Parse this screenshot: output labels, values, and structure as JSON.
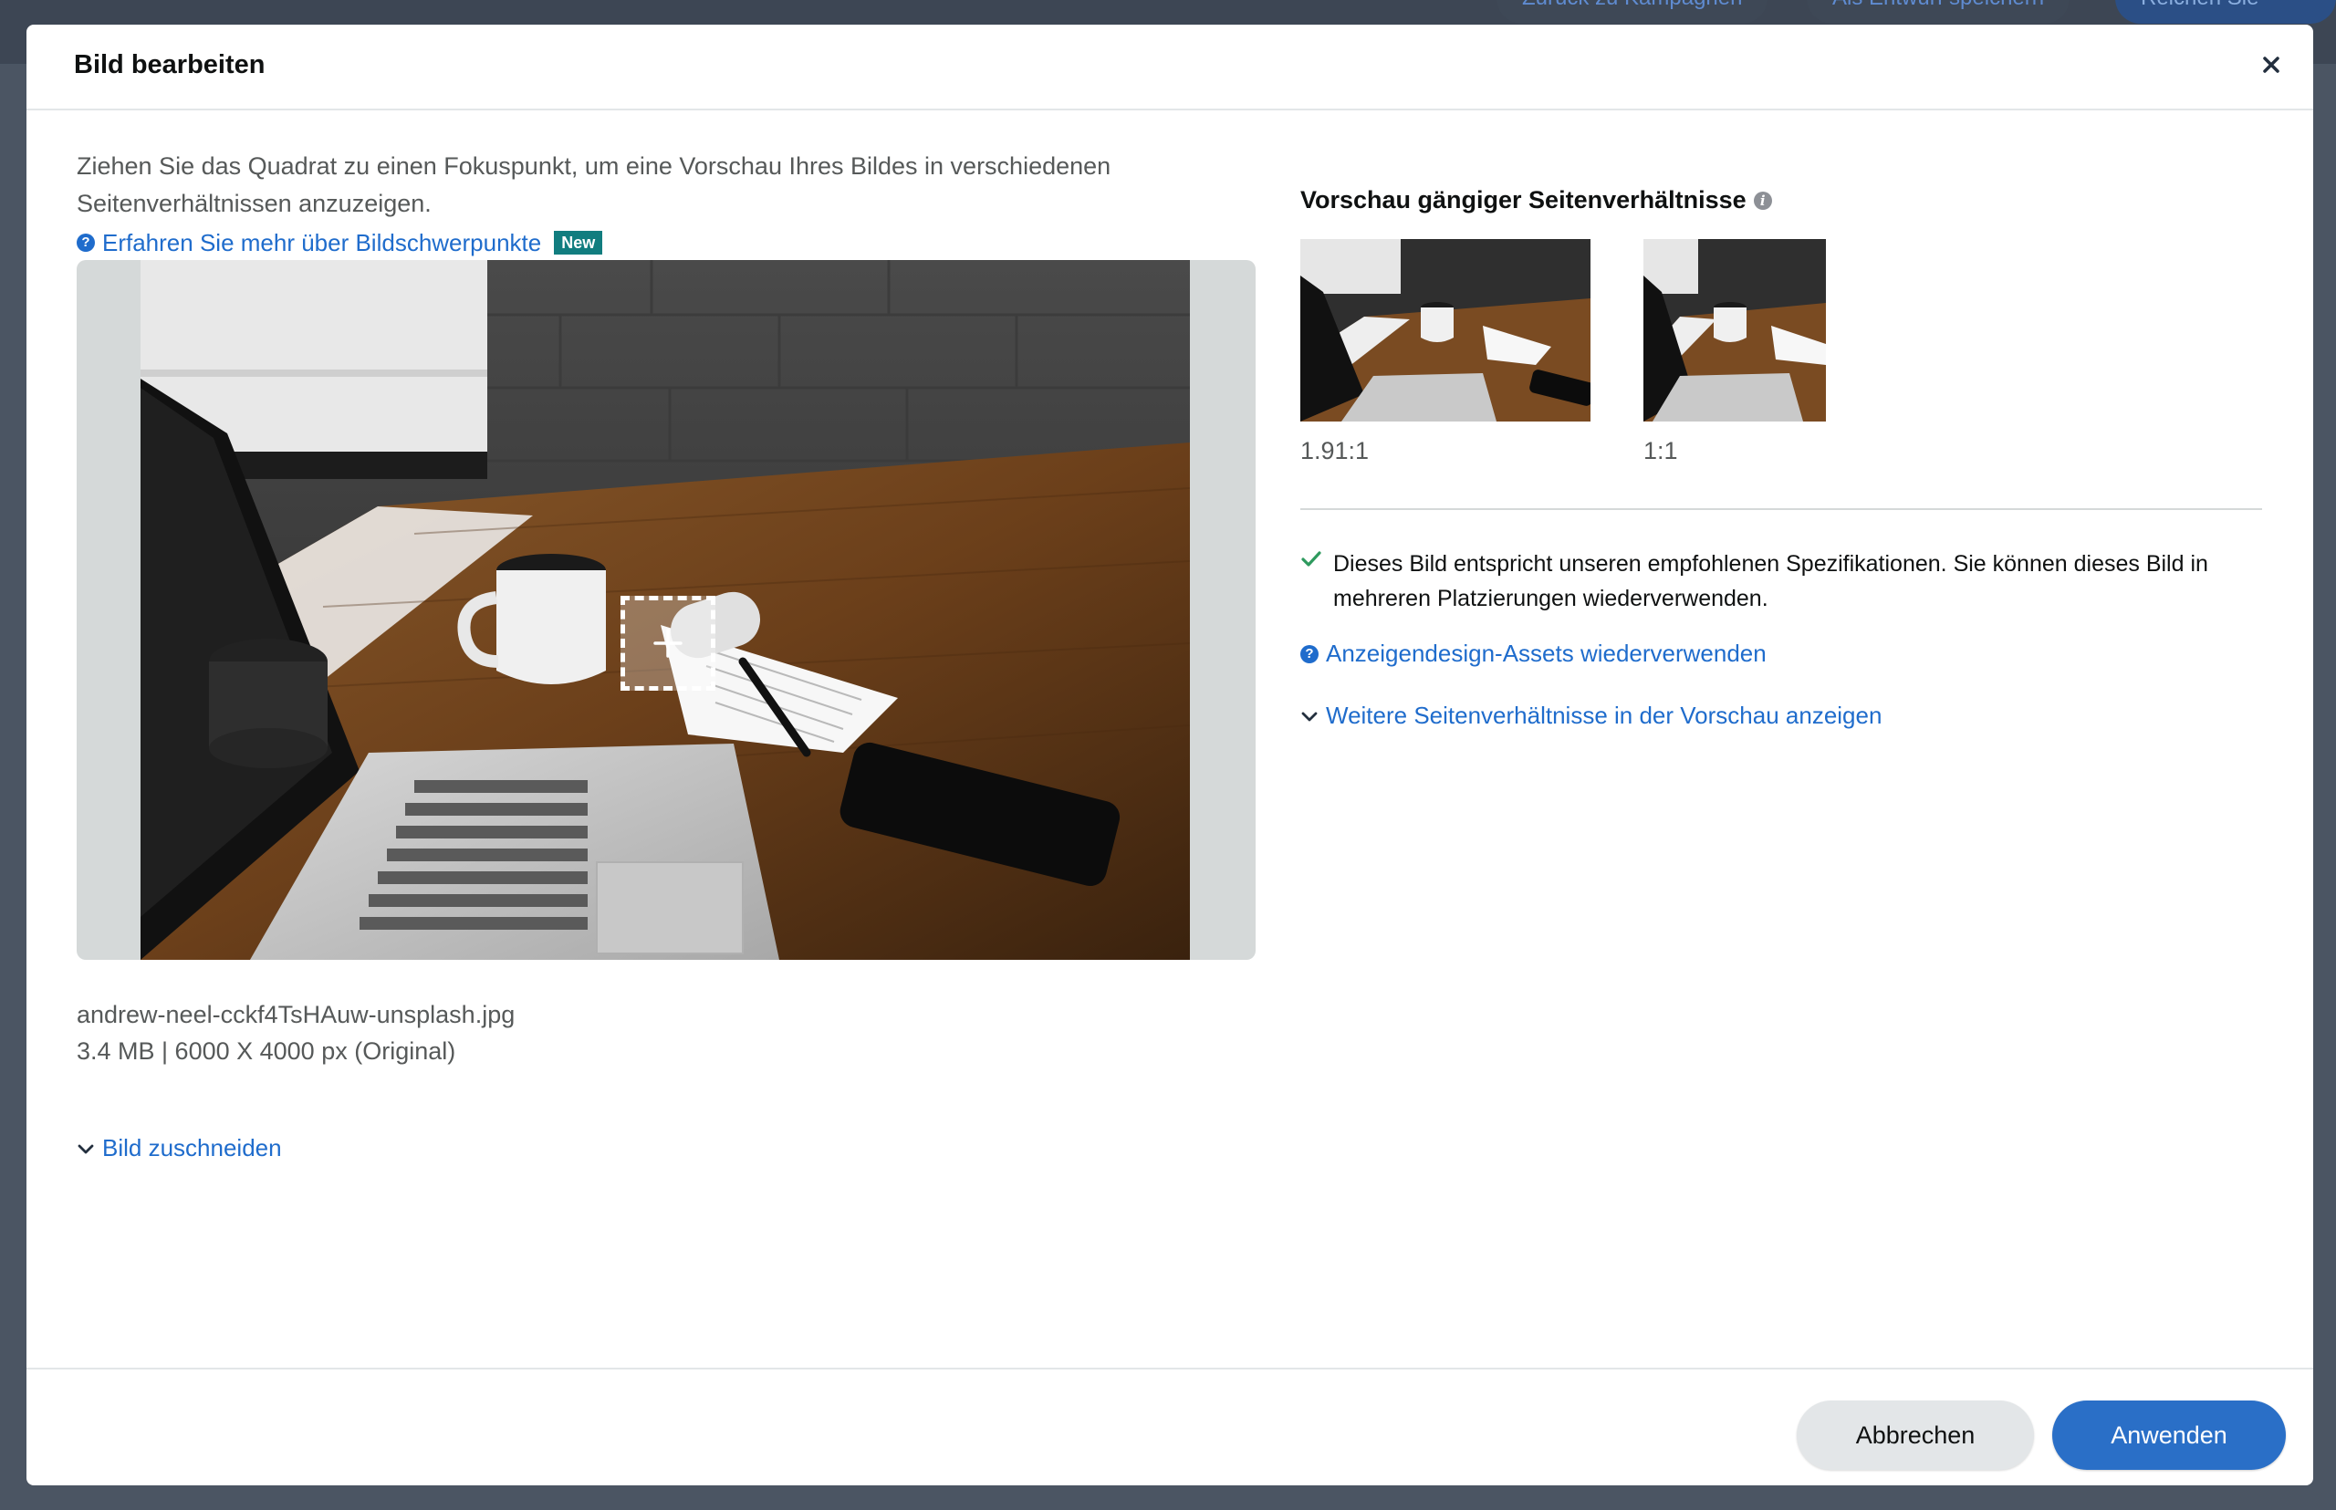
{
  "background": {
    "buttons": [
      "Zurück zu Kampagnen",
      "Als Entwurf speichern",
      "Reichen Sie diese"
    ]
  },
  "modal": {
    "title": "Bild bearbeiten",
    "close_icon": "close-icon",
    "intro_text": "Ziehen Sie das Quadrat zu einen Fokuspunkt, um eine Vorschau Ihres Bildes in verschiedenen Seitenverhältnissen anzuzeigen.",
    "learn_more_link": "Erfahren Sie mehr über Bildschwerpunkte",
    "learn_more_badge": "New",
    "file": {
      "name": "andrew-neel-cckf4TsHAuw-unsplash.jpg",
      "meta": "3.4 MB | 6000 X 4000 px (Original)"
    },
    "crop_toggle": "Bild zuschneiden",
    "preview": {
      "title": "Vorschau gängiger Seitenverhältnisse",
      "ratios": [
        {
          "label": "1.91:1"
        },
        {
          "label": "1:1"
        }
      ]
    },
    "spec_message": "Dieses Bild entspricht unseren empfohlenen Spezifikationen. Sie können dieses Bild in mehreren Platzierungen wiederverwenden.",
    "reuse_link": "Anzeigendesign-Assets wiederverwenden",
    "more_ratios_link": "Weitere Seitenverhältnisse in der Vorschau anzeigen",
    "buttons": {
      "cancel": "Abbrechen",
      "apply": "Anwenden"
    },
    "colors": {
      "link": "#1f6ccc",
      "primary_button": "#2a6fc7",
      "badge": "#117d7f",
      "check": "#2e9a5e"
    }
  }
}
